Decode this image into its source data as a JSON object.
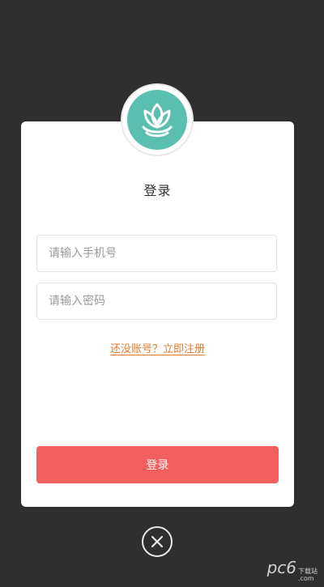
{
  "login": {
    "title": "登录",
    "phone_placeholder": "请输入手机号",
    "password_placeholder": "请输入密码",
    "register_link": "还没账号？立即注册",
    "submit_label": "登录"
  },
  "watermark": {
    "main": "pc6",
    "sub_top": "下载站",
    "sub_bottom": ".com"
  },
  "colors": {
    "background": "#2f2f2f",
    "accent": "#f25f5f",
    "link": "#e07a2c",
    "logo": "#5bbfaf"
  },
  "icons": {
    "logo": "lotus-logo-icon",
    "close": "close-circle-icon"
  }
}
